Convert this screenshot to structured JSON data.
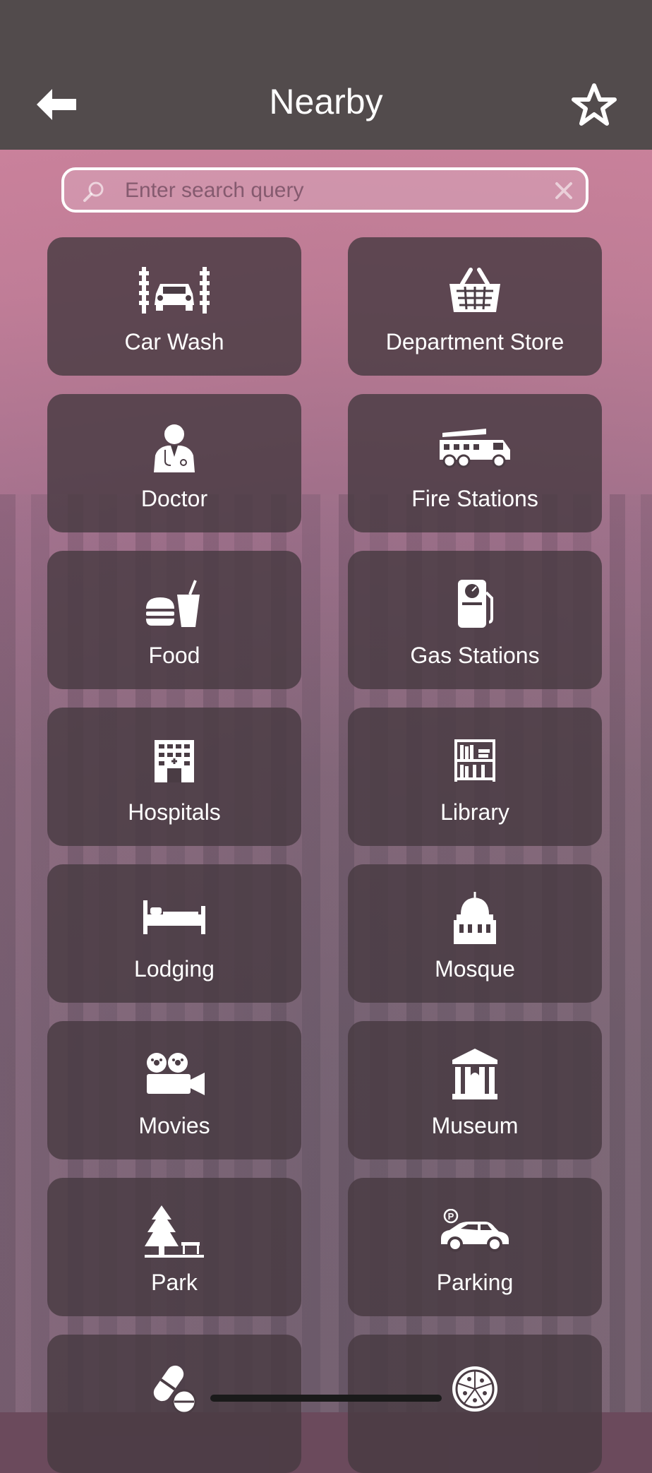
{
  "header": {
    "title": "Nearby",
    "back_icon": "back-arrow-icon",
    "favorite_icon": "star-icon"
  },
  "search": {
    "placeholder": "Enter search query",
    "value": ""
  },
  "categories": [
    {
      "label": "Car Wash",
      "icon": "car-wash-icon"
    },
    {
      "label": "Department Store",
      "icon": "shopping-basket-icon"
    },
    {
      "label": "Doctor",
      "icon": "doctor-icon"
    },
    {
      "label": "Fire Stations",
      "icon": "fire-truck-icon"
    },
    {
      "label": "Food",
      "icon": "fast-food-icon"
    },
    {
      "label": "Gas Stations",
      "icon": "gas-pump-icon"
    },
    {
      "label": "Hospitals",
      "icon": "hospital-icon"
    },
    {
      "label": "Library",
      "icon": "bookshelf-icon"
    },
    {
      "label": "Lodging",
      "icon": "bed-icon"
    },
    {
      "label": "Mosque",
      "icon": "mosque-icon"
    },
    {
      "label": "Movies",
      "icon": "movie-camera-icon"
    },
    {
      "label": "Museum",
      "icon": "museum-icon"
    },
    {
      "label": "Park",
      "icon": "park-icon"
    },
    {
      "label": "Parking",
      "icon": "parking-car-icon"
    },
    {
      "label": "",
      "icon": "pills-icon"
    },
    {
      "label": "",
      "icon": "pizza-icon"
    }
  ]
}
